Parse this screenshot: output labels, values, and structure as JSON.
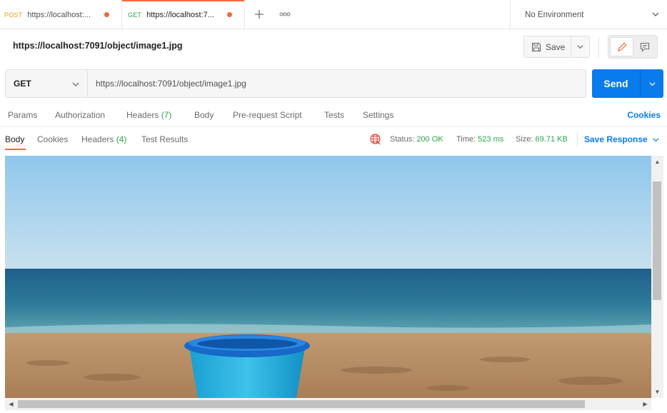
{
  "tabs": [
    {
      "method": "POST",
      "url": "https://localhost:...",
      "unsaved": true,
      "active": false
    },
    {
      "method": "GET",
      "url": "https://localhost:7...",
      "unsaved": true,
      "active": true
    }
  ],
  "tab_controls": {
    "new_tab_icon": "plus-icon",
    "more_icon": "ellipsis-icon"
  },
  "environment": {
    "selected": "No Environment"
  },
  "request": {
    "title": "https://localhost:7091/object/image1.jpg",
    "method": "GET",
    "url": "https://localhost:7091/object/image1.jpg"
  },
  "toolbar": {
    "save_label": "Save",
    "send_label": "Send"
  },
  "request_tabs": [
    {
      "label": "Params"
    },
    {
      "label": "Authorization"
    },
    {
      "label": "Headers",
      "count": "(7)"
    },
    {
      "label": "Body"
    },
    {
      "label": "Pre-request Script"
    },
    {
      "label": "Tests"
    },
    {
      "label": "Settings"
    }
  ],
  "cookies_link": "Cookies",
  "response": {
    "tabs": [
      {
        "label": "Body",
        "active": true
      },
      {
        "label": "Cookies"
      },
      {
        "label": "Headers",
        "count": "(4)"
      },
      {
        "label": "Test Results"
      }
    ],
    "status_label": "Status:",
    "status_value": "200 OK",
    "time_label": "Time:",
    "time_value": "523 ms",
    "size_label": "Size:",
    "size_value": "69.71 KB",
    "save_response_label": "Save Response"
  },
  "colors": {
    "accent_orange": "#f26b3a",
    "send_blue": "#097bed",
    "success_green": "#2da44e",
    "post_yellow": "#e8a317"
  }
}
